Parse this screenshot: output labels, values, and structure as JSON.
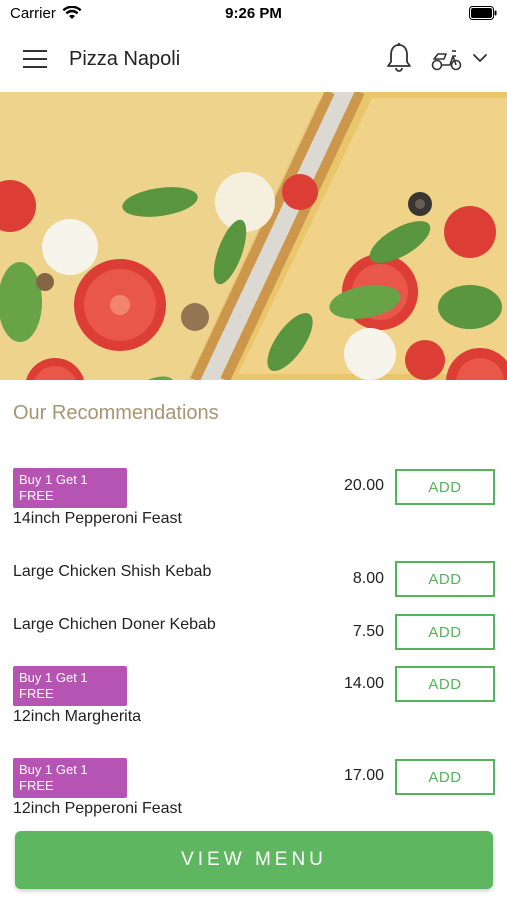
{
  "status_bar": {
    "carrier": "Carrier",
    "time": "9:26 PM"
  },
  "nav": {
    "title": "Pizza Napoli",
    "icons": [
      "hamburger-icon",
      "bell-icon",
      "scooter-icon",
      "chevron-down-icon"
    ]
  },
  "hero": {
    "image": "pizza-photo"
  },
  "section": {
    "title": "Our Recommendations"
  },
  "items": [
    {
      "badge": "Buy 1 Get 1 FREE",
      "name": "14inch Pepperoni Feast",
      "price": "20.00",
      "add_label": "ADD"
    },
    {
      "badge": "",
      "name": "Large Chicken Shish Kebab",
      "price": "8.00",
      "add_label": "ADD"
    },
    {
      "badge": "",
      "name": "Large Chichen Doner Kebab",
      "price": "7.50",
      "add_label": "ADD"
    },
    {
      "badge": "Buy 1 Get 1 FREE",
      "name": "12inch Margherita",
      "price": "14.00",
      "add_label": "ADD"
    },
    {
      "badge": "Buy 1 Get 1 FREE",
      "name": "12inch Pepperoni Feast",
      "price": "17.00",
      "add_label": "ADD"
    }
  ],
  "footer": {
    "view_menu_label": "VIEW MENU"
  },
  "colors": {
    "accent_green": "#54b45e",
    "badge_purple": "#b554b3",
    "section_title": "#a69571"
  }
}
